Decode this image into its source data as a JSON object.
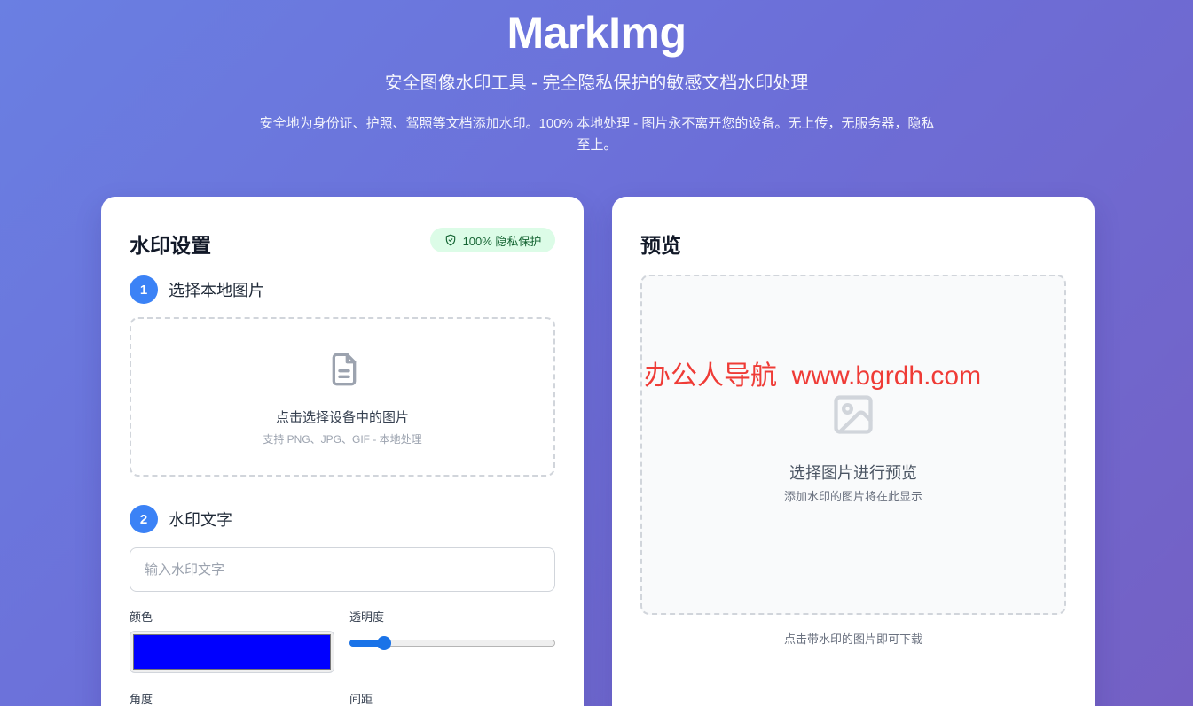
{
  "hero": {
    "title": "MarkImg",
    "subtitle": "安全图像水印工具 - 完全隐私保护的敏感文档水印处理",
    "description": "安全地为身份证、护照、驾照等文档添加水印。100% 本地处理 - 图片永不离开您的设备。无上传，无服务器，隐私至上。"
  },
  "settings": {
    "title": "水印设置",
    "privacy_badge": "100% 隐私保护",
    "step1": {
      "number": "1",
      "label": "选择本地图片"
    },
    "upload": {
      "text": "点击选择设备中的图片",
      "hint": "支持 PNG、JPG、GIF - 本地处理"
    },
    "step2": {
      "number": "2",
      "label": "水印文字"
    },
    "text_input": {
      "placeholder": "输入水印文字",
      "value": ""
    },
    "color": {
      "label": "颜色",
      "value": "#0000ff"
    },
    "opacity": {
      "label": "透明度",
      "value_percent": 17
    },
    "angle": {
      "label": "角度"
    },
    "spacing": {
      "label": "间距"
    }
  },
  "preview": {
    "title": "预览",
    "empty_text": "选择图片进行预览",
    "empty_hint": "添加水印的图片将在此显示",
    "download_hint": "点击带水印的图片即可下载"
  },
  "overlay": {
    "site_watermark": "办公人导航  www.bgrdh.com"
  },
  "colors": {
    "accent": "#3b82f6",
    "badge_bg": "#dcfce7",
    "badge_text": "#166534",
    "watermark": "#ef3b36"
  },
  "icons": {
    "badge": "shield-check-icon",
    "upload": "file-text-icon",
    "preview": "image-icon"
  }
}
